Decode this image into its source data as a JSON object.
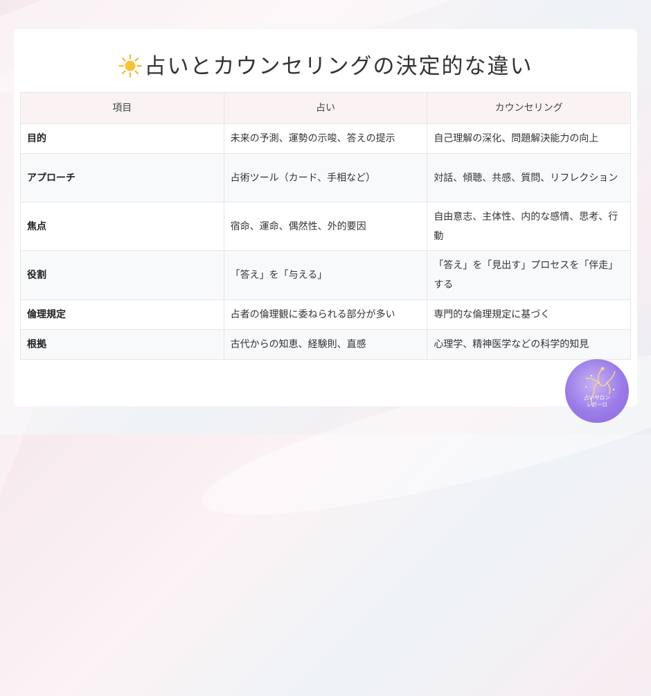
{
  "title": "占いとカウンセリングの決定的な違い",
  "title_icon": "sun-icon",
  "table": {
    "headers": [
      "項目",
      "占い",
      "カウンセリング"
    ],
    "rows": [
      [
        "目的",
        "未来の予測、運勢の示唆、答えの提示",
        "自己理解の深化、問題解決能力の向上"
      ],
      [
        "アプローチ",
        "占術ツール（カード、手相など）",
        "対話、傾聴、共感、質問、リフレクション"
      ],
      [
        "焦点",
        "宿命、運命、偶然性、外的要因",
        "自由意志、主体性、内的な感情、思考、行動"
      ],
      [
        "役割",
        "「答え」を「与える」",
        "「答え」を「見出す」プロセスを「伴走」する"
      ],
      [
        "倫理規定",
        "占者の倫理観に委ねられる部分が多い",
        "専門的な倫理規定に基づく"
      ],
      [
        "根拠",
        "古代からの知恵、経験則、直感",
        "心理学、精神医学などの科学的知見"
      ]
    ]
  },
  "logo": {
    "text_line1": "占いサロン",
    "text_line2": "レガーロ",
    "colors": {
      "primary": "#9a7be8",
      "accent": "#f2d488"
    }
  },
  "colors": {
    "header_bg": "#fbf3f3",
    "alt_row_bg": "#f8f9fb",
    "sun": "#f5b62a"
  }
}
